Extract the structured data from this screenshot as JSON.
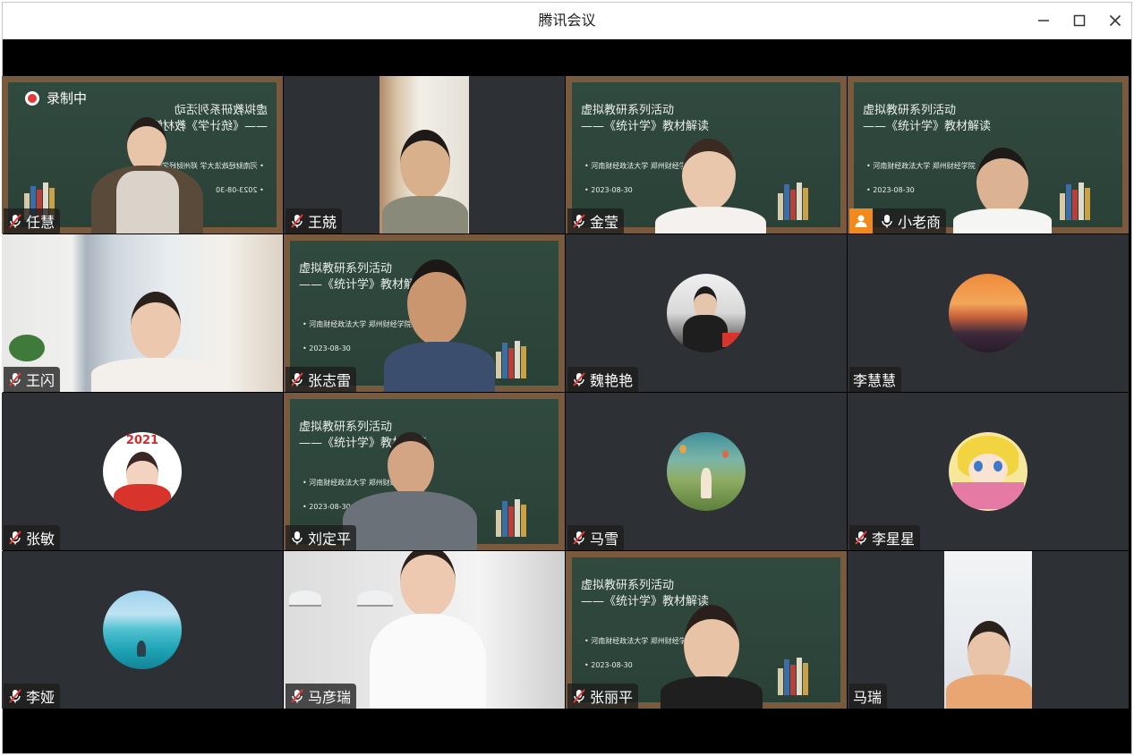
{
  "window": {
    "title": "腾讯会议"
  },
  "recording": {
    "label": "录制中"
  },
  "board_text": {
    "line1": "虚拟教研系列活动",
    "line2": "——《统计学》教材解读",
    "line3": "• 河南财经政法大学   郑州财经学院",
    "line4": "• 2023-08-30"
  },
  "participants": [
    {
      "name": "任慧",
      "mic": "muted"
    },
    {
      "name": "王兢",
      "mic": "muted"
    },
    {
      "name": "金莹",
      "mic": "muted"
    },
    {
      "name": "小老商",
      "mic": "on",
      "host": true
    },
    {
      "name": "王闪",
      "mic": "muted"
    },
    {
      "name": "张志雷",
      "mic": "muted"
    },
    {
      "name": "魏艳艳",
      "mic": "muted"
    },
    {
      "name": "李慧慧",
      "mic": "none"
    },
    {
      "name": "张敏",
      "mic": "muted"
    },
    {
      "name": "刘定平",
      "mic": "on"
    },
    {
      "name": "马雪",
      "mic": "muted"
    },
    {
      "name": "李星星",
      "mic": "muted"
    },
    {
      "name": "李娅",
      "mic": "muted"
    },
    {
      "name": "马彦瑞",
      "mic": "muted"
    },
    {
      "name": "张丽平",
      "mic": "muted"
    },
    {
      "name": "马瑞",
      "mic": "none"
    }
  ],
  "colors": {
    "tile_bg": "#2d3035",
    "board": "#2f463c",
    "frame": "#7a5a3c",
    "active_border": "#56c06a",
    "host_badge": "#f08a1d",
    "record": "#e53935"
  }
}
